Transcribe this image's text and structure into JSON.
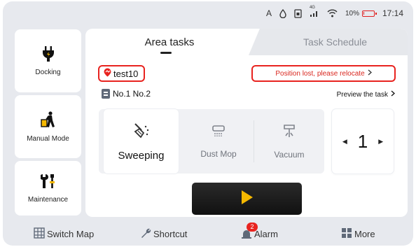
{
  "status_bar": {
    "input_indicator": "A",
    "network_type": "4G",
    "battery_percent": "10%",
    "battery_level": 0.1,
    "time": "17:14"
  },
  "sidebar": {
    "items": [
      {
        "label": "Docking",
        "icon": "plug-icon"
      },
      {
        "label": "Manual Mode",
        "icon": "person-pushing-icon"
      },
      {
        "label": "Maintenance",
        "icon": "tools-icon"
      }
    ]
  },
  "tabs": [
    {
      "label": "Area tasks",
      "active": true
    },
    {
      "label": "Task Schedule",
      "active": false
    }
  ],
  "map": {
    "name": "test10"
  },
  "warning": {
    "text": "Position lost, please relocate"
  },
  "zones": {
    "text": "No.1 No.2"
  },
  "preview": {
    "label": "Preview the task"
  },
  "modes": [
    {
      "label": "Sweeping",
      "icon": "sweeping-icon",
      "selected": true
    },
    {
      "label": "Dust Mop",
      "icon": "dust-mop-icon",
      "selected": false
    },
    {
      "label": "Vacuum",
      "icon": "vacuum-icon",
      "selected": false
    }
  ],
  "counter": {
    "value": "1"
  },
  "bottom_bar": {
    "items": [
      {
        "label": "Switch Map",
        "icon": "switch-map-icon"
      },
      {
        "label": "Shortcut",
        "icon": "wrench-icon"
      },
      {
        "label": "Alarm",
        "icon": "alarm-icon",
        "badge": "2"
      },
      {
        "label": "More",
        "icon": "grid-icon"
      }
    ]
  },
  "colors": {
    "accent_red": "#e8231f",
    "play_yellow": "#f5b800",
    "background": "#e7e9ee"
  }
}
